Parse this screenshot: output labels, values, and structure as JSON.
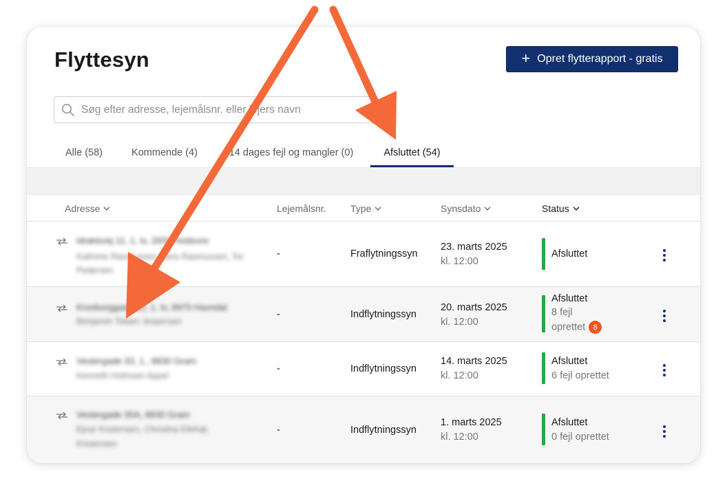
{
  "page": {
    "title": "Flyttesyn",
    "create_button_label": "Opret flytterapport - gratis",
    "search_placeholder": "Søg efter adresse, lejemålsnr. eller lejers navn"
  },
  "tabs": [
    {
      "label": "Alle (58)",
      "active": false
    },
    {
      "label": "Kommende (4)",
      "active": false
    },
    {
      "label": "14 dages fejl og mangler (0)",
      "active": false
    },
    {
      "label": "Afsluttet (54)",
      "active": true
    }
  ],
  "table": {
    "headers": {
      "address": "Adresse",
      "lease_no": "Lejemålsnr.",
      "type": "Type",
      "date": "Synsdato",
      "status": "Status"
    },
    "rows": [
      {
        "address": "Idrætsvej 11, 1. tv, 2650 Hvidovre",
        "tenants": "Kathrine Rasmussen, Jens Rasmussen, Tor Pedersen",
        "lease_no": "-",
        "type": "Fraflytningssyn",
        "date": "23. marts 2025",
        "time": "kl. 12:00",
        "status": "Afsluttet",
        "status_sub": "",
        "badge": ""
      },
      {
        "address": "Kronborggade 12, 1. tv, 8970 Havndal",
        "tenants": "Benjamin Tolsen Jespersen",
        "lease_no": "-",
        "type": "Indflytningssyn",
        "date": "20. marts 2025",
        "time": "kl. 12:00",
        "status": "Afsluttet",
        "status_sub": "8 fejl",
        "status_sub2": "oprettet",
        "badge": "8"
      },
      {
        "address": "Vestergade 33, 1., 8830 Gram",
        "tenants": "Kenneth Holmsen Appel",
        "lease_no": "-",
        "type": "Indflytningssyn",
        "date": "14. marts 2025",
        "time": "kl. 12:00",
        "status": "Afsluttet",
        "status_sub": "6 fejl oprettet",
        "badge": ""
      },
      {
        "address": "Vestergade 35A, 8830 Gram",
        "tenants": "Ejnar Kristensen, Christina Ellehøj",
        "tenants2": "Kristensen",
        "lease_no": "-",
        "type": "Indflytningssyn",
        "date": "1. marts 2025",
        "time": "kl. 12:00",
        "status": "Afsluttet",
        "status_sub": "0 fejl oprettet",
        "badge": ""
      }
    ]
  },
  "colors": {
    "brand": "#13306e",
    "status_done": "#29a745",
    "badge": "#f2551f",
    "annotation_arrow": "#f4693a"
  },
  "icons": {
    "search": "search-icon",
    "swap": "swap-arrows-icon",
    "menu": "kebab-menu-icon",
    "plus": "plus-icon",
    "chevron": "chevron-down-icon"
  }
}
